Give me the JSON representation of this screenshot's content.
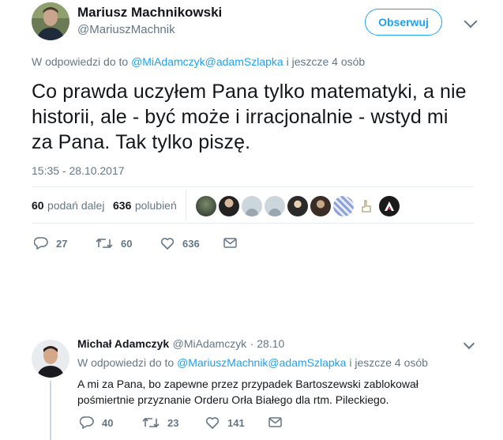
{
  "tweet": {
    "author_name": "Mariusz Machnikowski",
    "author_handle": "@MariuszMachnik",
    "follow_label": "Obserwuj",
    "reply_prefix": "W odpowiedzi do to",
    "reply_handles": "@MiAdamczyk@adamSzlapka",
    "reply_suffix": "i jeszcze 4 osób",
    "text": "Co prawda uczyłem Pana tylko matematyki, a nie historii, ale - być może i irracjonalnie - wstyd mi za Pana. Tak tylko piszę.",
    "timestamp": "15:35 - 28.10.2017",
    "retweets_count": "60",
    "retweets_label": "podań dalej",
    "likes_count": "636",
    "likes_label": "polubień",
    "actions": {
      "replies": "27",
      "retweets": "60",
      "likes": "636"
    }
  },
  "reply": {
    "author_name": "Michał Adamczyk",
    "author_handle": "@MiAdamczyk",
    "date": "· 28.10",
    "reply_prefix": "W odpowiedzi do to",
    "reply_handles": "@MariuszMachnik@adamSzlapka",
    "reply_suffix": "i jeszcze 4 osób",
    "text": "A mi za Pana, bo zapewne przez przypadek Bartoszewski zablokował pośmiertnie przyznanie Orderu Orła Białego dla rtm. Pileckiego.",
    "actions": {
      "replies": "40",
      "retweets": "23",
      "likes": "141"
    }
  },
  "colors": {
    "accent": "#1da1f2",
    "muted": "#657786",
    "text": "#14171a"
  },
  "icons": [
    "reply-icon",
    "retweet-icon",
    "heart-icon",
    "mail-icon",
    "chevron-down-icon"
  ]
}
